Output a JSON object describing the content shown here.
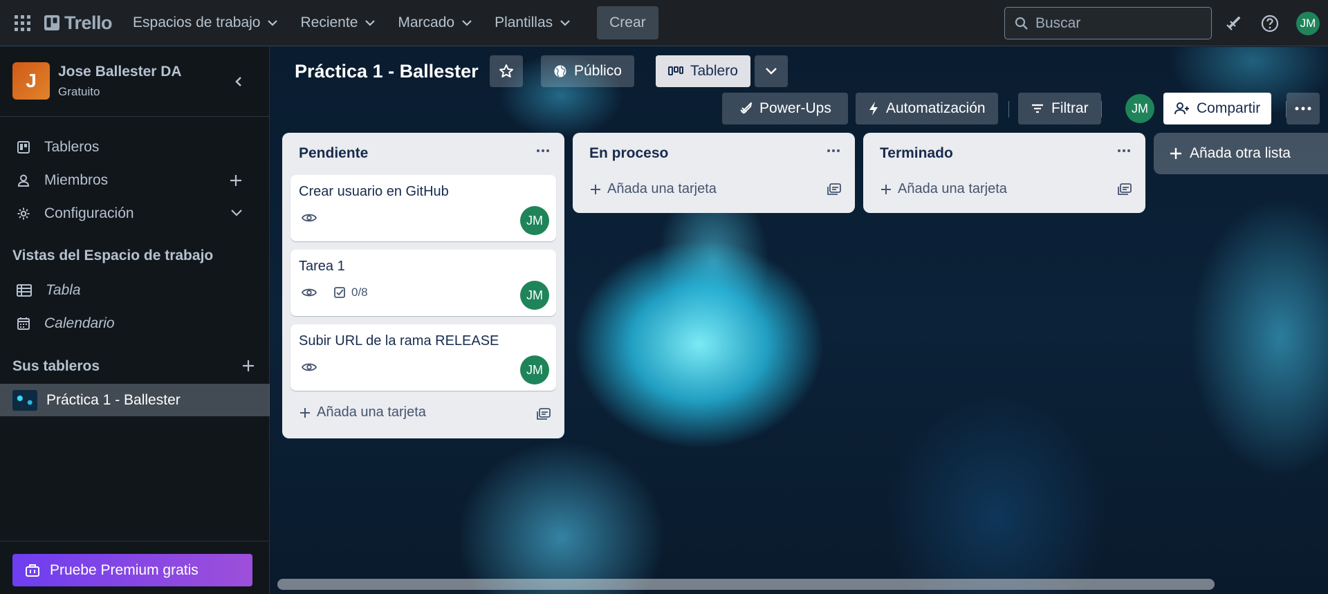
{
  "nav": {
    "brand": "Trello",
    "menus": [
      "Espacios de trabajo",
      "Reciente",
      "Marcado",
      "Plantillas"
    ],
    "create_label": "Crear",
    "search_placeholder": "Buscar",
    "user_initials": "JM"
  },
  "sidebar": {
    "workspace_initial": "J",
    "workspace_name": "Jose Ballester DA",
    "workspace_plan": "Gratuito",
    "items": [
      {
        "label": "Tableros"
      },
      {
        "label": "Miembros"
      },
      {
        "label": "Configuración"
      }
    ],
    "views_heading": "Vistas del Espacio de trabajo",
    "views": [
      {
        "label": "Tabla"
      },
      {
        "label": "Calendario"
      }
    ],
    "boards_heading": "Sus tableros",
    "boards": [
      {
        "label": "Práctica 1 - Ballester"
      }
    ],
    "premium_label": "Pruebe Premium gratis"
  },
  "board": {
    "title": "Práctica 1 - Ballester",
    "visibility_label": "Público",
    "view_label": "Tablero",
    "powerups_label": "Power-Ups",
    "automation_label": "Automatización",
    "filter_label": "Filtrar",
    "member_initials": "JM",
    "share_label": "Compartir",
    "add_list_label": "Añada otra lista",
    "add_card_label": "Añada una tarjeta",
    "lists": [
      {
        "title": "Pendiente",
        "cards": [
          {
            "title": "Crear usuario en GitHub",
            "member": "JM"
          },
          {
            "title": "Tarea 1",
            "checklist": "0/8",
            "member": "JM"
          },
          {
            "title": "Subir URL de la rama RELEASE",
            "member": "JM"
          }
        ]
      },
      {
        "title": "En proceso",
        "cards": []
      },
      {
        "title": "Terminado",
        "cards": []
      }
    ]
  },
  "colors": {
    "nav_bg": "#1d2125",
    "sidebar_bg": "#11161b",
    "list_bg": "#ebecf0",
    "avatar_green": "#1f845a",
    "premium_gradient_start": "#6e3ef0",
    "premium_gradient_end": "#9d4fd9"
  }
}
